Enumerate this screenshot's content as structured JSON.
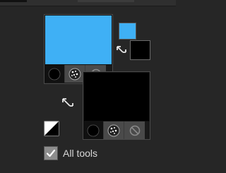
{
  "colors": {
    "fill": "#3fb0f5",
    "stroke": "#000000",
    "panel_bg": "#262626"
  },
  "fill_swatch": {
    "color": "#3fb0f5",
    "modes": [
      {
        "name": "solid-color-mode-icon",
        "active": false
      },
      {
        "name": "gradient-mode-icon",
        "active": false
      },
      {
        "name": "none-mode-icon",
        "active": false
      }
    ]
  },
  "stroke_swatch": {
    "color": "#000000",
    "modes": [
      {
        "name": "solid-color-mode-icon",
        "active": false
      },
      {
        "name": "gradient-mode-icon",
        "active": false
      },
      {
        "name": "none-mode-icon",
        "active": false
      }
    ]
  },
  "mini_preview": {
    "fill_color": "#3fb0f5",
    "stroke_color": "#000000"
  },
  "icons": {
    "swap_small": "swap-colors-icon",
    "swap_large": "swap-colors-icon",
    "reset": "default-colors-icon"
  },
  "all_tools": {
    "label": "All tools",
    "checked": true
  }
}
